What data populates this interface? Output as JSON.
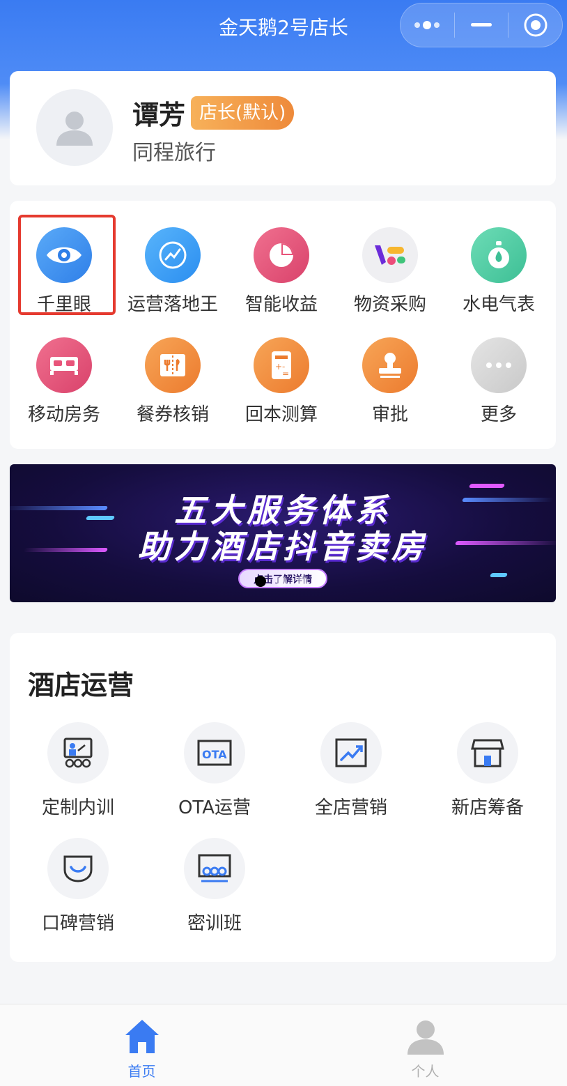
{
  "navbar": {
    "title": "金天鹅2号店长",
    "menu_icon": "more-dots-icon",
    "minimize_icon": "minimize-icon",
    "close_icon": "target-close-icon"
  },
  "profile": {
    "name": "谭芳",
    "role": "店长(默认)",
    "company": "同程旅行"
  },
  "quick_actions": [
    {
      "label": "千里眼",
      "icon": "eye-icon",
      "color": "#3a8ff0"
    },
    {
      "label": "运营落地王",
      "icon": "trend-icon",
      "color": "#3aa0f5"
    },
    {
      "label": "智能收益",
      "icon": "pie-chart-icon",
      "color": "#e8547a"
    },
    {
      "label": "物资采购",
      "icon": "vf-logo-icon",
      "color": "#eeeeee"
    },
    {
      "label": "水电气表",
      "icon": "meter-icon",
      "color": "#4ed1a7"
    },
    {
      "label": "移动房务",
      "icon": "bed-icon",
      "color": "#e8547a"
    },
    {
      "label": "餐券核销",
      "icon": "ticket-icon",
      "color": "#f28a3c"
    },
    {
      "label": "回本测算",
      "icon": "calculator-icon",
      "color": "#f28a3c"
    },
    {
      "label": "审批",
      "icon": "stamp-icon",
      "color": "#f28a3c"
    },
    {
      "label": "更多",
      "icon": "more-icon",
      "color": "#d6d6d6"
    }
  ],
  "banner": {
    "line1": "五大服务体系",
    "line2": "助力酒店抖音卖房",
    "button": "点击了解详情",
    "active_dot": 0,
    "dot_count": 3
  },
  "hotel_ops": {
    "title": "酒店运营",
    "items": [
      {
        "label": "定制内训",
        "icon": "training-icon"
      },
      {
        "label": "OTA运营",
        "icon": "ota-icon"
      },
      {
        "label": "全店营销",
        "icon": "chart-up-icon"
      },
      {
        "label": "新店筹备",
        "icon": "store-icon"
      },
      {
        "label": "口碑营销",
        "icon": "smile-icon"
      },
      {
        "label": "密训班",
        "icon": "classroom-icon"
      }
    ]
  },
  "tabbar": {
    "home": "首页",
    "profile": "个人",
    "active_color": "#3a7bf2",
    "inactive_color": "#b0b0b0"
  }
}
